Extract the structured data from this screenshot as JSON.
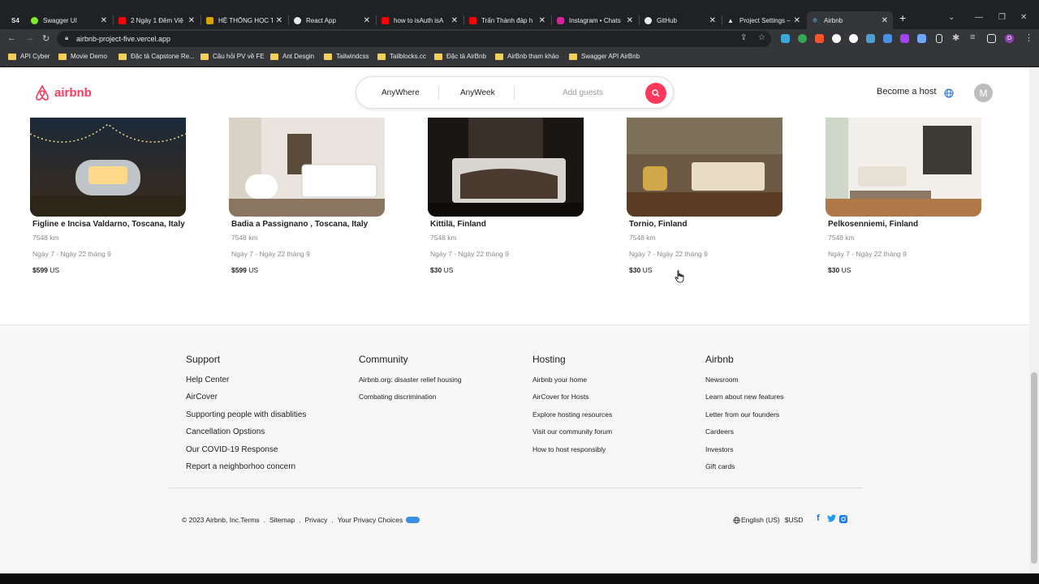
{
  "browser": {
    "tabs": [
      {
        "title": "S4",
        "color": "#2b2b2b"
      },
      {
        "title": "Swagger UI",
        "color": "#85ea2d"
      },
      {
        "title": "2 Ngày 1 Đêm Việ",
        "color": "#ff0000"
      },
      {
        "title": "HỆ THỐNG HỌC T",
        "color": "#d9a400"
      },
      {
        "title": "React App",
        "color": "#e8eaed"
      },
      {
        "title": "how to isAuth isA",
        "color": "#ff0000"
      },
      {
        "title": "Trấn Thành đáp h",
        "color": "#ff0000"
      },
      {
        "title": "Instagram • Chats",
        "color": "#d6249f"
      },
      {
        "title": "GitHub",
        "color": "#e8eaed"
      },
      {
        "title": "Project Settings –",
        "color": "#e8eaed"
      },
      {
        "title": "Airbnb",
        "color": "#61dafb"
      }
    ],
    "url": "airbnb-project-five.vercel.app",
    "bookmarks": [
      "API Cyber",
      "Movie Demo",
      "Đặc tả Capstone Re...",
      "Câu hỏi PV về FE",
      "Ant Desgin",
      "Tailwindcss",
      "Tailblocks.cc",
      "Đặc tả AirBnb",
      "AirBnb tham khảo",
      "Swagger API AirBnb"
    ]
  },
  "header": {
    "logo": "airbnb",
    "search": {
      "where": "AnyWhere",
      "week": "AnyWeek",
      "guests": "Add guests"
    },
    "host": "Become a host",
    "avatar": "M"
  },
  "listings": [
    {
      "name": "Figline e Incisa Valdarno, Toscana, Italy",
      "distance": "7548 km",
      "dates": "Ngày 7 - Ngày 22 tháng 9",
      "price": "$599",
      "currency": "US"
    },
    {
      "name": "Badia a Passignano , Toscana, Italy",
      "distance": "7548 km",
      "dates": "Ngày 7 - Ngày 22 tháng 9",
      "price": "$599",
      "currency": "US"
    },
    {
      "name": "Kittilä, Finland",
      "distance": "7548 km",
      "dates": "Ngày 7 - Ngày 22 tháng 9",
      "price": "$30",
      "currency": "US"
    },
    {
      "name": "Tornio, Finland",
      "distance": "7548 km",
      "dates": "Ngày 7 - Ngày 22 tháng 9",
      "price": "$30",
      "currency": "US"
    },
    {
      "name": "Pelkosenniemi, Finland",
      "distance": "7548 km",
      "dates": "Ngày 7 - Ngày 22 tháng 9",
      "price": "$30",
      "currency": "US"
    }
  ],
  "footer": {
    "support": {
      "title": "Support",
      "links": [
        "Help Center",
        "AirCover",
        "Supporting people with disablities",
        "Cancellation Opstions",
        "Our COVID-19 Response",
        "Report a neighborhoo concern"
      ]
    },
    "community": {
      "title": "Community",
      "links": [
        "Airbnb.org: disaster relief housing",
        "Combating discrimination"
      ]
    },
    "hosting": {
      "title": "Hosting",
      "links": [
        "Airbnb your home",
        "AirCover for Hosts",
        "Explore hosting resources",
        "Visit our community forum",
        "How to host responsibly"
      ]
    },
    "airbnb": {
      "title": "Airbnb",
      "links": [
        "Newsroom",
        "Learn about new features",
        "Letter from our founders",
        "Cardeers",
        "Investors",
        "Gift cards"
      ]
    },
    "copyright": "© 2023 Airbnb, Inc.",
    "terms": "Terms",
    "sitemap": "Sitemap",
    "privacy": "Privacy",
    "privacy_choices": "Your Privacy Choices",
    "language": "English (US)",
    "currency": "$USD"
  }
}
